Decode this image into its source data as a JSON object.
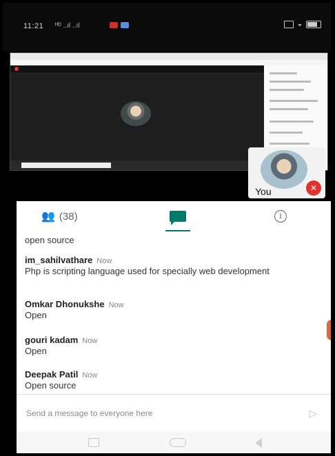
{
  "status_bar": {
    "time": "11:21",
    "signal_text": "ᴴᴰ ..ıl ..ıl ",
    "icons": [
      "red-notification-icon",
      "blue-notification-icon"
    ],
    "right_icons": [
      "cast-icon",
      "wifi-icon",
      "battery-icon"
    ]
  },
  "video": {
    "self_label": "You",
    "mic_icon": "mic-off-icon"
  },
  "tabs": {
    "people_count": "(38)",
    "people_icon": "people-icon",
    "chat_icon": "chat-icon",
    "info_icon": "info-icon",
    "info_glyph": "i"
  },
  "messages": [
    {
      "sender": "",
      "time": "",
      "text": "open source"
    },
    {
      "sender": "im_sahilvathare",
      "time": "Now",
      "text": "Php is scripting language used for specially web development"
    },
    {
      "sender": "Omkar Dhonukshe",
      "time": "Now",
      "text": "Open"
    },
    {
      "sender": "gouri kadam",
      "time": "Now",
      "text": "Open"
    },
    {
      "sender": "Deepak Patil",
      "time": "Now",
      "text": "Open source"
    }
  ],
  "compose": {
    "placeholder": "Send a message to everyone here",
    "send_icon": "send-icon"
  },
  "colors": {
    "accent": "#00796b",
    "mic_off": "#e0332e"
  }
}
